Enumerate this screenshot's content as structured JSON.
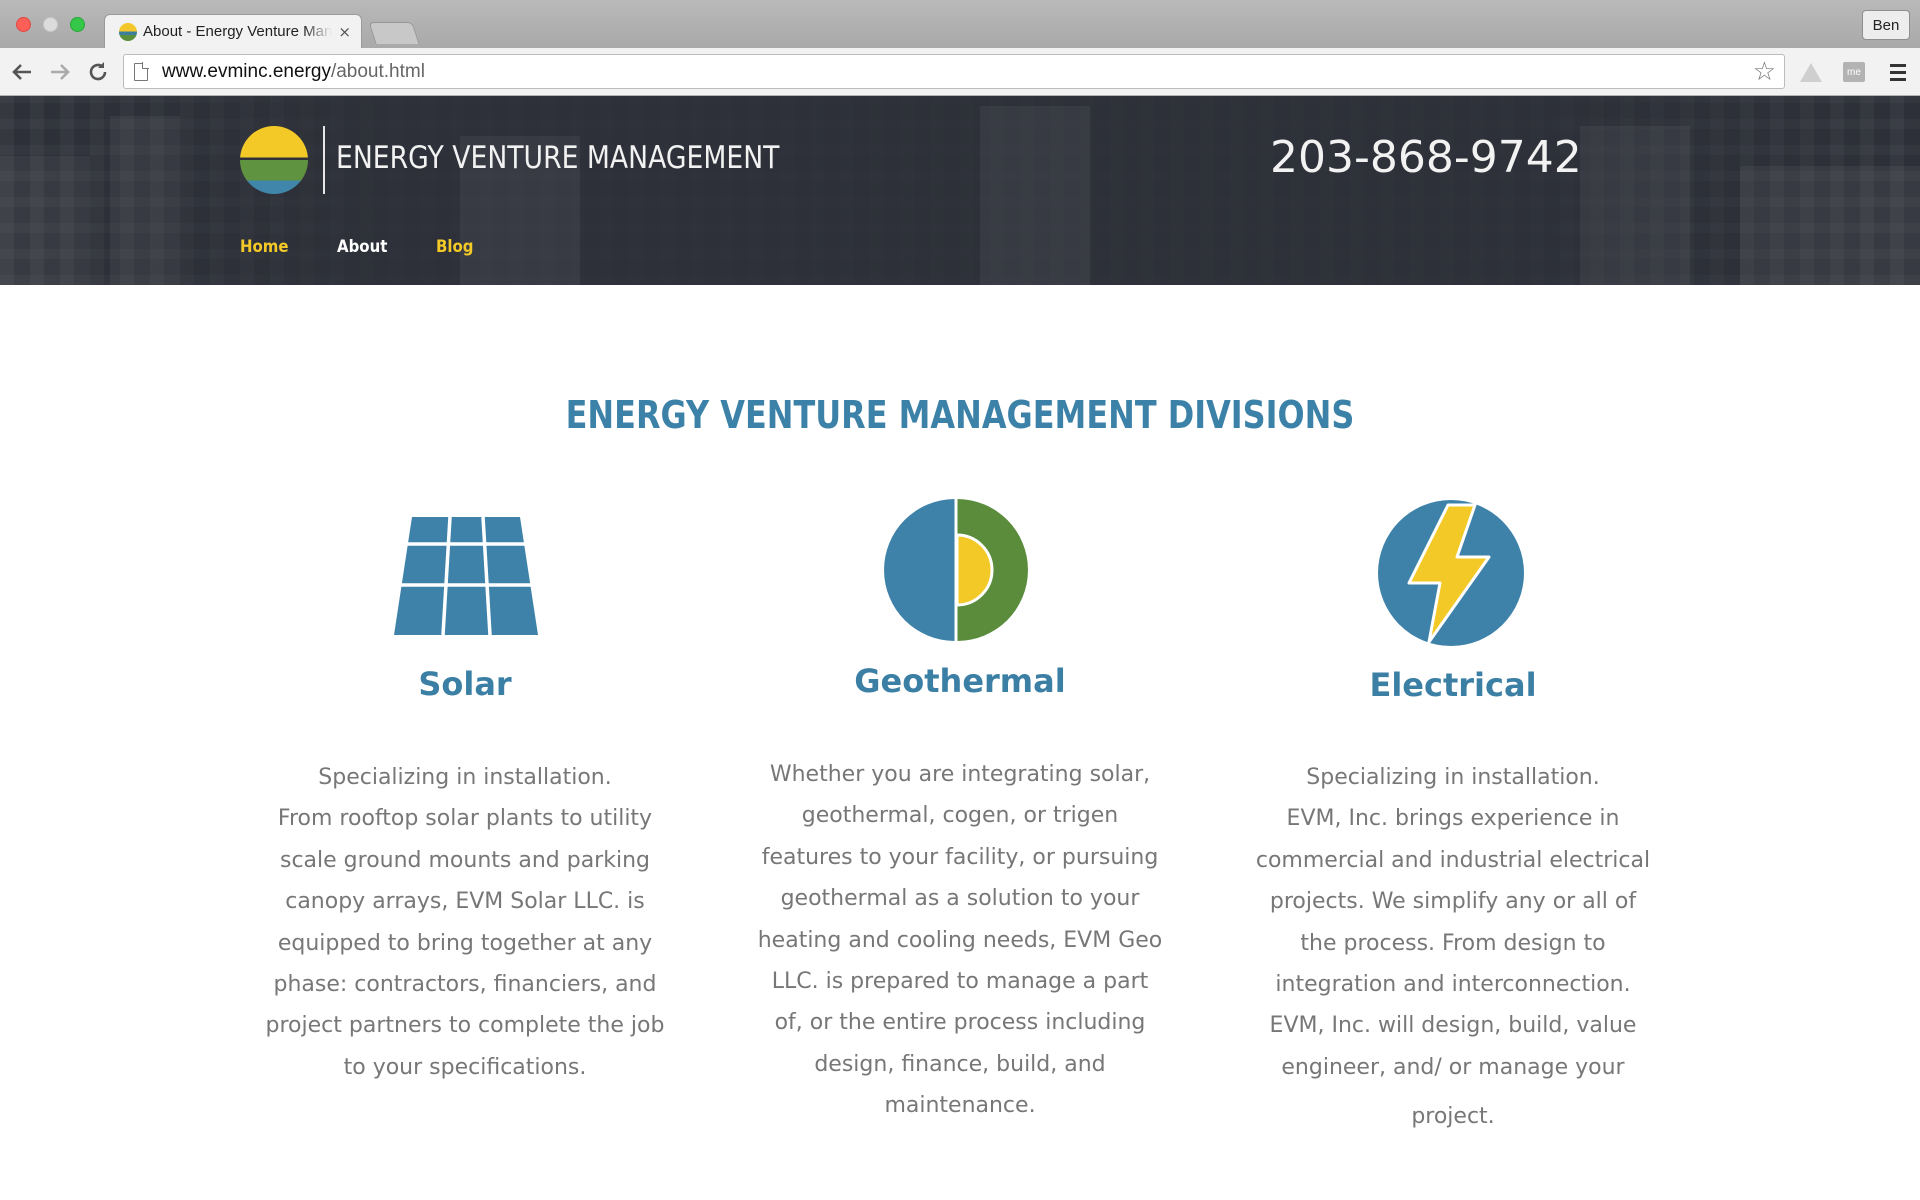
{
  "browser": {
    "tab_title": "About - Energy Venture Management",
    "tab_close": "×",
    "profile_name": "Ben",
    "url_host": "www.evminc.energy",
    "url_path": "/about.html",
    "ext_me_label": "me"
  },
  "header": {
    "company_name": "ENERGY VENTURE MANAGEMENT",
    "phone": "203-868-9742",
    "nav": {
      "home": "Home",
      "about": "About",
      "blog": "Blog"
    }
  },
  "main": {
    "section_title": "ENERGY VENTURE MANAGEMENT DIVISIONS",
    "divisions": [
      {
        "name": "Solar",
        "icon": "solar-panel-icon",
        "lines": [
          "Specializing in installation.",
          "From rooftop solar plants to utility",
          "scale ground mounts and parking",
          "canopy arrays, EVM Solar LLC. is",
          "equipped to bring together at any",
          "phase: contractors, financiers, and",
          "project partners to complete the job",
          "to your specifications."
        ]
      },
      {
        "name": "Geothermal",
        "icon": "geothermal-icon",
        "lines": [
          "Whether you are integrating solar,",
          "geothermal, cogen, or trigen",
          "features to  your facility, or pursuing",
          "geothermal as a solution to your",
          "heating and cooling needs, EVM Geo",
          "LLC. is prepared to manage a part",
          "of, or the entire process including",
          "design, finance, build, and",
          "maintenance."
        ]
      },
      {
        "name": "Electrical",
        "icon": "lightning-bolt-icon",
        "lines": [
          "Specializing in installation.",
          "EVM, Inc. brings experience in",
          "commercial and industrial electrical",
          "projects. We simplify any or all of",
          "the process. From design to",
          "integration and interconnection.",
          "EVM, Inc. will design, build, value",
          "engineer, and/ or manage your",
          "project."
        ]
      }
    ]
  },
  "colors": {
    "brand_blue": "#3c82a8",
    "brand_yellow": "#f3c927",
    "brand_green": "#5a8c3c",
    "header_bg": "#2d3038",
    "body_text": "#777777"
  }
}
